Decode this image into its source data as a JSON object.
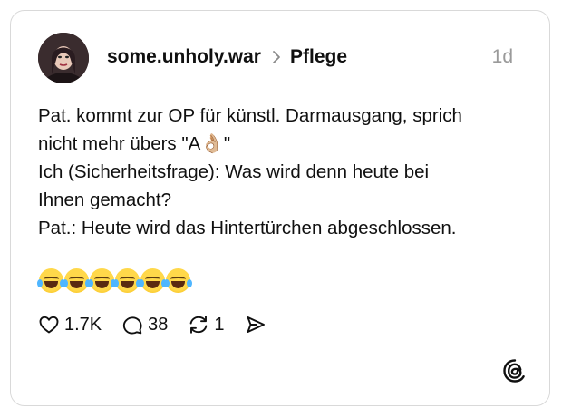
{
  "post": {
    "username": "some.unholy.war",
    "topic": "Pflege",
    "time": "1d",
    "lines": [
      "Pat. kommt zur OP für künstl. Darmausgang, sprich",
      "nicht mehr übers \"A👌🏼\"",
      "Ich (Sicherheitsfrage): Was wird denn heute bei",
      "Ihnen gemacht?",
      "Pat.: Heute wird das Hintertürchen abgeschlossen."
    ],
    "emoji_count": 6,
    "emoji_name": "face-with-tears-of-joy"
  },
  "actions": {
    "likes": "1.7K",
    "replies": "38",
    "reposts": "1"
  },
  "icons": {
    "like": "heart-icon",
    "reply": "comment-bubble-icon",
    "repost": "repost-arrows-icon",
    "share": "send-icon",
    "brand": "threads-logo-icon"
  }
}
